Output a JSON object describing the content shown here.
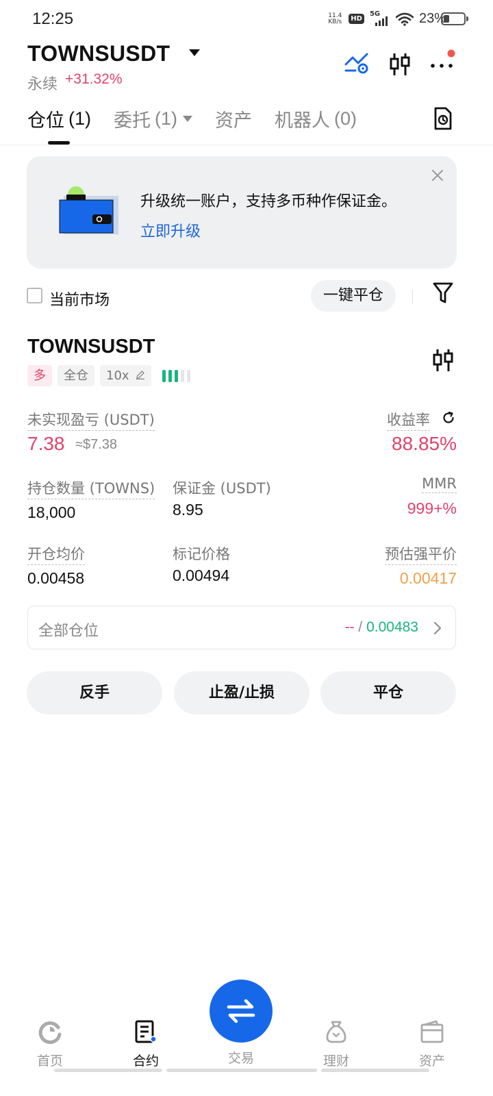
{
  "status_bar": {
    "time": "12:25",
    "net_speed_value": "11.4",
    "net_speed_unit": "KB/s",
    "hd": "HD",
    "network": "5G",
    "battery": "23%",
    "battery_level": 0.23
  },
  "header": {
    "symbol": "TOWNSUSDT",
    "contract_type": "永续",
    "change": "+31.32%",
    "icons": [
      "price-alert-icon",
      "candlestick-chart-icon",
      "more-icon"
    ]
  },
  "tabs": [
    {
      "label": "仓位",
      "count": "(1)"
    },
    {
      "label": "委托",
      "count": "(1)"
    },
    {
      "label": "资产",
      "count": ""
    },
    {
      "label": "机器人",
      "count": "(0)"
    }
  ],
  "banner": {
    "text": "升级统一账户，支持多币种作保证金。",
    "link": "立即升级"
  },
  "filter_row": {
    "current_market_label": "当前市场",
    "close_all_label": "一键平仓"
  },
  "position": {
    "symbol": "TOWNSUSDT",
    "side": "多",
    "margin_mode": "全仓",
    "leverage": "10x",
    "risk_level": 3,
    "unrealized_pnl_label": "未实现盈亏 (USDT)",
    "unrealized_pnl": "7.38",
    "unrealized_pnl_usd": "≈$7.38",
    "roi_label": "收益率",
    "roi": "88.85%",
    "size_label": "持仓数量 (TOWNS)",
    "size": "18,000",
    "margin_label": "保证金 (USDT)",
    "margin": "8.95",
    "mmr_label": "MMR",
    "mmr": "999+%",
    "entry_price_label": "开仓均价",
    "entry_price": "0.00458",
    "mark_price_label": "标记价格",
    "mark_price": "0.00494",
    "liq_price_label": "预估强平价",
    "liq_price": "0.00417",
    "all_positions_label": "全部仓位",
    "all_positions_value_a": "--",
    "all_positions_sep": " / ",
    "all_positions_value_b": "0.00483"
  },
  "actions": {
    "reverse": "反手",
    "tp_sl": "止盈/止损",
    "close": "平仓"
  },
  "bottom_nav": [
    {
      "label": "首页",
      "icon": "home-icon"
    },
    {
      "label": "合约",
      "icon": "futures-icon"
    },
    {
      "label": "交易",
      "icon": "swap-icon"
    },
    {
      "label": "理财",
      "icon": "earn-icon"
    },
    {
      "label": "资产",
      "icon": "wallet-icon"
    }
  ],
  "colors": {
    "accent_blue": "#1768e8",
    "link_blue": "#1d66d8",
    "red": "#e0436b",
    "green": "#19b57e",
    "orange": "#f0a04b"
  }
}
